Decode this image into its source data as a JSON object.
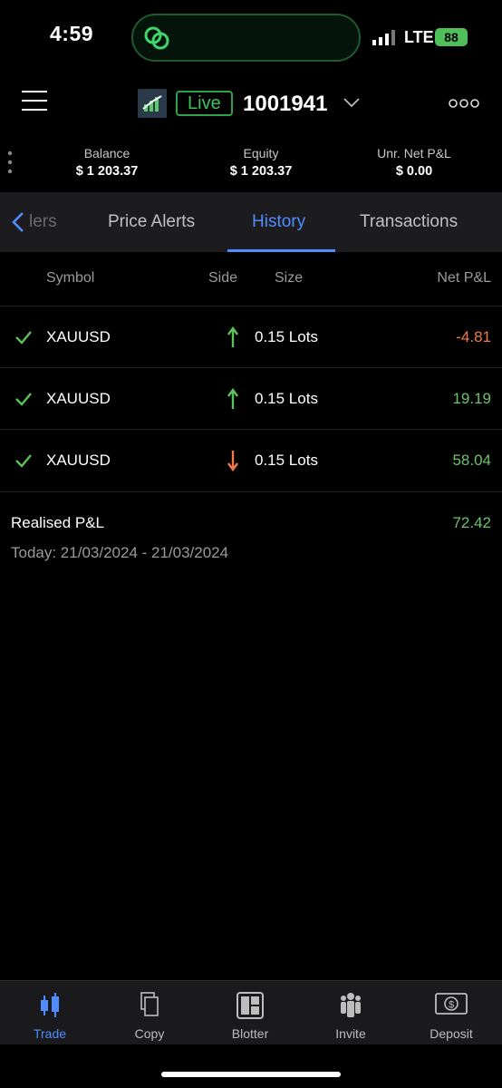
{
  "status": {
    "time": "4:59",
    "network": "LTE",
    "battery": "88"
  },
  "header": {
    "mode_label": "Live",
    "account_number": "1001941"
  },
  "summary": {
    "balance_label": "Balance",
    "balance_value": "$ 1 203.37",
    "equity_label": "Equity",
    "equity_value": "$ 1 203.37",
    "pnl_label": "Unr. Net P&L",
    "pnl_value": "$ 0.00"
  },
  "tabs": {
    "partial_label": "lers",
    "items": [
      "Price Alerts",
      "History",
      "Transactions"
    ],
    "active": "History"
  },
  "table": {
    "headers": {
      "symbol": "Symbol",
      "side": "Side",
      "size": "Size",
      "pnl": "Net P&L"
    },
    "rows": [
      {
        "symbol": "XAUUSD",
        "side": "buy",
        "size": "0.15 Lots",
        "pnl": "-4.81"
      },
      {
        "symbol": "XAUUSD",
        "side": "buy",
        "size": "0.15 Lots",
        "pnl": "19.19"
      },
      {
        "symbol": "XAUUSD",
        "side": "sell",
        "size": "0.15 Lots",
        "pnl": "58.04"
      }
    ]
  },
  "realised": {
    "label": "Realised P&L",
    "value": "72.42",
    "range": "Today: 21/03/2024 - 21/03/2024"
  },
  "nav": {
    "items": [
      "Trade",
      "Copy",
      "Blotter",
      "Invite",
      "Deposit"
    ],
    "active": "Trade"
  },
  "colors": {
    "accent": "#4e8cff",
    "profit": "#6cc36a",
    "loss": "#f07a4a",
    "live": "#3ec25a"
  }
}
